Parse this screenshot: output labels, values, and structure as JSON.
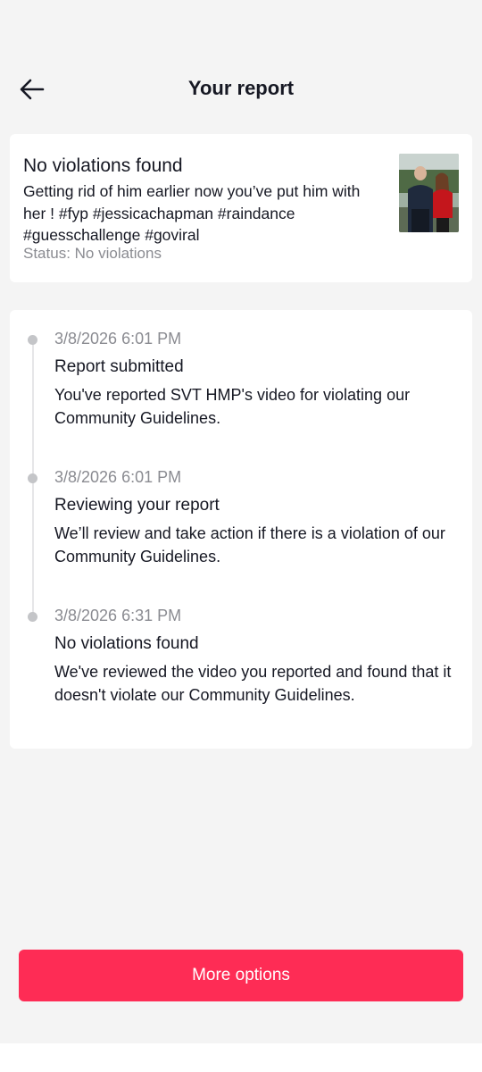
{
  "header": {
    "back_icon": "arrow-left-icon",
    "title": "Your report"
  },
  "summary": {
    "title": "No violations found",
    "description": "Getting rid of him earlier now you’ve put him with her ! #fyp #jessicachapman #raindance #guesschallenge #goviral",
    "status": "Status: No violations"
  },
  "timeline": {
    "steps": [
      {
        "time": "3/8/2026 6:01 PM",
        "title": "Report submitted",
        "description": "You've reported SVT HMP's video for violating our Community Guidelines."
      },
      {
        "time": "3/8/2026 6:01 PM",
        "title": "Reviewing your report",
        "description": "We’ll review and take action if there is a violation of our Community Guidelines."
      },
      {
        "time": "3/8/2026 6:31 PM",
        "title": "No violations found",
        "description": "We've reviewed the video you reported and found that it doesn't violate our Community Guidelines."
      }
    ]
  },
  "actions": {
    "more_options_label": "More options"
  },
  "colors": {
    "accent": "#fe2c55",
    "background": "#f4f4f4",
    "card": "#ffffff",
    "secondary_text": "#8a8b91"
  }
}
